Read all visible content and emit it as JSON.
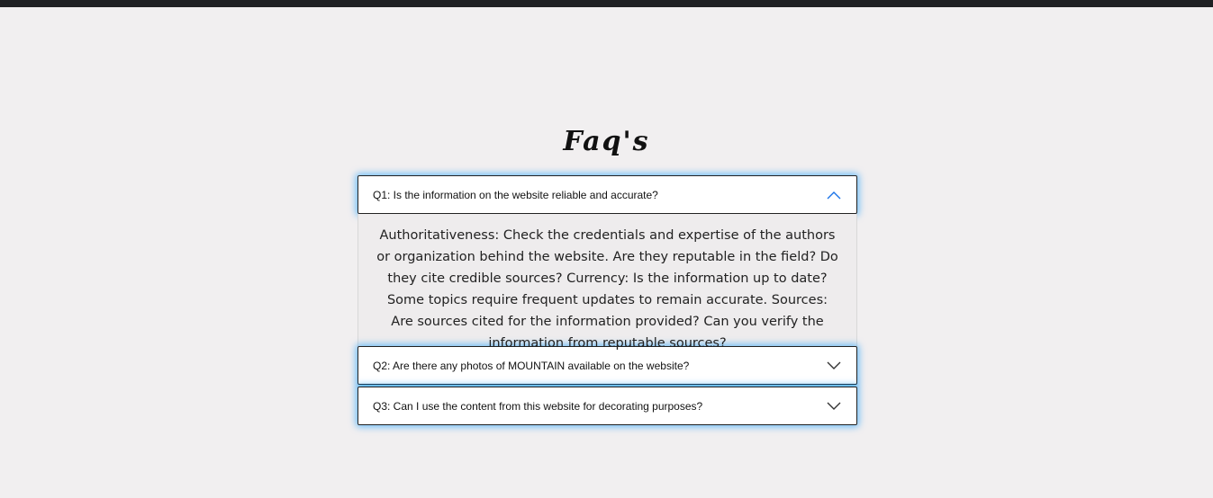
{
  "page": {
    "title": "Faq's"
  },
  "faq": {
    "items": [
      {
        "question": "Q1: Is the information on the website reliable and accurate?",
        "expanded": true,
        "icon": "chevron-up-icon",
        "answer": "Authoritativeness: Check the credentials and expertise of the authors or organization behind the website. Are they reputable in the field? Do they cite credible sources? Currency: Is the information up to date? Some topics require frequent updates to remain accurate. Sources: Are sources cited for the information provided? Can you verify the information from reputable sources?"
      },
      {
        "question": "Q2: Are there any photos of MOUNTAIN available on the website?",
        "expanded": false,
        "icon": "chevron-down-icon"
      },
      {
        "question": "Q3: Can I use the content from this website for decorating purposes?",
        "expanded": false,
        "icon": "chevron-down-icon"
      }
    ]
  },
  "colors": {
    "background": "#f1eff0",
    "top_bar": "#202124",
    "glow": "#0096ff",
    "chevron_active": "#1a73e8",
    "chevron": "#333333"
  }
}
